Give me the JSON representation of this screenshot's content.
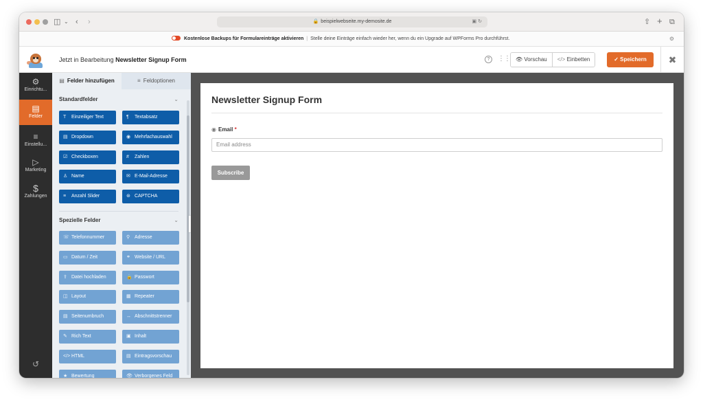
{
  "browser": {
    "url": "beispielwebseite.my-demosite.de",
    "icons": [
      "sidebar-icon",
      "chevron-down-icon",
      "back-icon",
      "forward-icon",
      "share-icon",
      "new-tab-icon",
      "tabs-overview-icon",
      "translate-icon",
      "reload-icon",
      "lock-icon"
    ]
  },
  "notice": {
    "strong": "Kostenlose Backups für Formulareinträge aktivieren",
    "text": "Stelle deine Einträge einfach wieder her, wenn du ein Upgrade auf WPForms Pro durchführst."
  },
  "header": {
    "editing_prefix": "Jetzt in Bearbeitung",
    "form_name": "Newsletter Signup Form",
    "preview_label": "Vorschau",
    "embed_label": "Einbetten",
    "save_label": "Speichern"
  },
  "leftnav": {
    "items": [
      {
        "label": "Einrichtu...",
        "icon": "gear-icon"
      },
      {
        "label": "Felder",
        "icon": "form-fields-icon",
        "active": true
      },
      {
        "label": "Einstellu...",
        "icon": "sliders-icon"
      },
      {
        "label": "Marketing",
        "icon": "megaphone-icon"
      },
      {
        "label": "Zahlungen",
        "icon": "dollar-icon"
      }
    ]
  },
  "panel": {
    "tabs": [
      {
        "label": "Felder hinzufügen",
        "active": true
      },
      {
        "label": "Feldoptionen",
        "active": false
      }
    ],
    "standard_title": "Standardfelder",
    "standard_fields": [
      "Einzeiliger Text",
      "Textabsatz",
      "Dropdown",
      "Mehrfachauswahl",
      "Checkboxen",
      "Zahlen",
      "Name",
      "E-Mail-Adresse",
      "Anzahl Slider",
      "CAPTCHA"
    ],
    "special_title": "Spezielle Felder",
    "special_fields": [
      "Telefonnummer",
      "Adresse",
      "Datum / Zeit",
      "Website / URL",
      "Datei hochladen",
      "Passwort",
      "Layout",
      "Repeater",
      "Seitenumbruch",
      "Abschnittstrenner",
      "Rich Text",
      "Inhalt",
      "HTML",
      "Eintragsvorschau",
      "Bewertung",
      "Verborgenes Feld"
    ]
  },
  "form": {
    "title": "Newsletter Signup Form",
    "field_label": "Email",
    "required_mark": "*",
    "placeholder": "Email address",
    "submit_label": "Subscribe"
  },
  "colors": {
    "accent": "#e26b2a",
    "standard_button": "#0e5da8",
    "special_button": "#72a3d3",
    "nav_bg": "#2d2d2d",
    "canvas_bg": "#525252"
  }
}
